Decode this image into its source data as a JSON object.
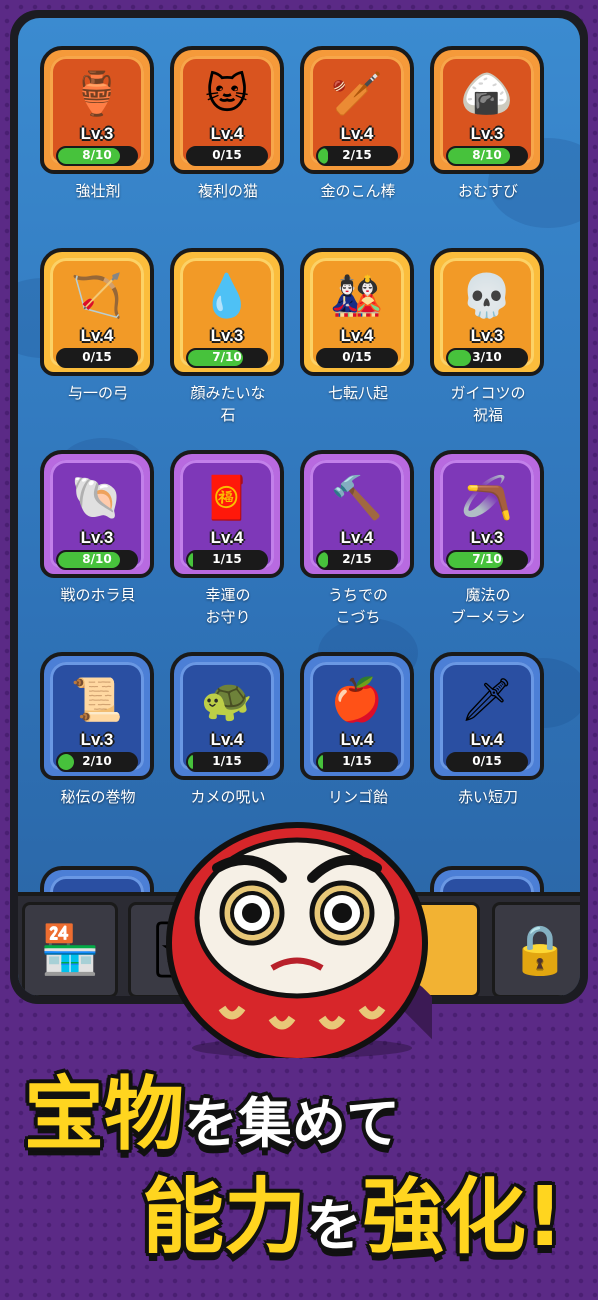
{
  "items": [
    {
      "name": "強壮剤",
      "level": "Lv.3",
      "progress": "8/10",
      "fill": 0.8,
      "tier": "red",
      "icon": "medicine-jar-icon",
      "glyph": "🏺"
    },
    {
      "name": "複利の猫",
      "level": "Lv.4",
      "progress": "0/15",
      "fill": 0.0,
      "tier": "red",
      "icon": "lucky-cat-icon",
      "glyph": "🐱"
    },
    {
      "name": "金のこん棒",
      "level": "Lv.4",
      "progress": "2/15",
      "fill": 0.13,
      "tier": "red",
      "icon": "golden-club-icon",
      "glyph": "🏏"
    },
    {
      "name": "おむすび",
      "level": "Lv.3",
      "progress": "8/10",
      "fill": 0.8,
      "tier": "red",
      "icon": "rice-ball-icon",
      "glyph": "🍙"
    },
    {
      "name": "与一の弓",
      "level": "Lv.4",
      "progress": "0/15",
      "fill": 0.0,
      "tier": "orange",
      "icon": "bow-icon",
      "glyph": "🏹"
    },
    {
      "name": "顔みたいな\n石",
      "level": "Lv.3",
      "progress": "7/10",
      "fill": 0.7,
      "tier": "orange",
      "icon": "face-stone-icon",
      "glyph": "💧"
    },
    {
      "name": "七転八起",
      "level": "Lv.4",
      "progress": "0/15",
      "fill": 0.0,
      "tier": "orange",
      "icon": "daruma-doll-icon",
      "glyph": "🎎"
    },
    {
      "name": "ガイコツの\n祝福",
      "level": "Lv.3",
      "progress": "3/10",
      "fill": 0.3,
      "tier": "orange",
      "icon": "skull-icon",
      "glyph": "💀"
    },
    {
      "name": "戦のホラ貝",
      "level": "Lv.3",
      "progress": "8/10",
      "fill": 0.8,
      "tier": "purple",
      "icon": "conch-shell-icon",
      "glyph": "🐚"
    },
    {
      "name": "幸運の\nお守り",
      "level": "Lv.4",
      "progress": "1/15",
      "fill": 0.07,
      "tier": "purple",
      "icon": "amulet-icon",
      "glyph": "🧧"
    },
    {
      "name": "うちでの\nこづち",
      "level": "Lv.4",
      "progress": "2/15",
      "fill": 0.13,
      "tier": "purple",
      "icon": "magic-mallet-icon",
      "glyph": "🔨"
    },
    {
      "name": "魔法の\nブーメラン",
      "level": "Lv.3",
      "progress": "7/10",
      "fill": 0.7,
      "tier": "purple",
      "icon": "boomerang-icon",
      "glyph": "🪃"
    },
    {
      "name": "秘伝の巻物",
      "level": "Lv.3",
      "progress": "2/10",
      "fill": 0.2,
      "tier": "blue",
      "icon": "scroll-icon",
      "glyph": "📜"
    },
    {
      "name": "カメの呪い",
      "level": "Lv.4",
      "progress": "1/15",
      "fill": 0.07,
      "tier": "blue",
      "icon": "turtle-icon",
      "glyph": "🐢"
    },
    {
      "name": "リンゴ飴",
      "level": "Lv.4",
      "progress": "1/15",
      "fill": 0.07,
      "tier": "blue",
      "icon": "candy-apple-icon",
      "glyph": "🍎"
    },
    {
      "name": "赤い短刀",
      "level": "Lv.4",
      "progress": "0/15",
      "fill": 0.0,
      "tier": "blue",
      "icon": "dagger-icon",
      "glyph": "🗡"
    }
  ],
  "tabs": [
    {
      "icon": "shop-stall-icon",
      "glyph": "🏪",
      "active": false
    },
    {
      "icon": "item-card-icon",
      "glyph": "🃏",
      "active": false
    },
    {
      "icon": "daruma-tab-icon",
      "glyph": "",
      "active": true
    },
    {
      "icon": "lock-icon",
      "glyph": "🔒",
      "active": false
    }
  ],
  "caption": {
    "line1_big": "宝物",
    "line1_small": "を集めて",
    "line2_big1": "能力",
    "line2_small": "を",
    "line2_big2": "強化!"
  }
}
